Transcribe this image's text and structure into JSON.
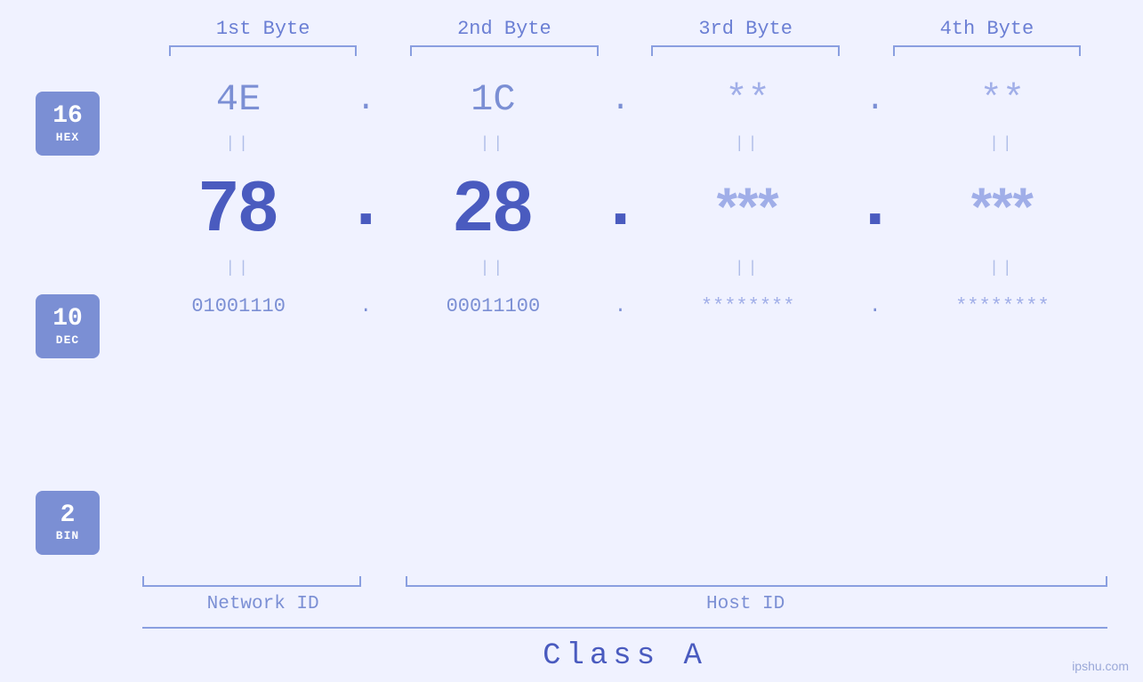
{
  "header": {
    "byte1": "1st Byte",
    "byte2": "2nd Byte",
    "byte3": "3rd Byte",
    "byte4": "4th Byte"
  },
  "badges": {
    "hex": {
      "number": "16",
      "label": "HEX"
    },
    "dec": {
      "number": "10",
      "label": "DEC"
    },
    "bin": {
      "number": "2",
      "label": "BIN"
    }
  },
  "values": {
    "hex": [
      "4E",
      "1C",
      "**",
      "**"
    ],
    "dec": [
      "78",
      "28",
      "***",
      "***"
    ],
    "bin": [
      "01001110",
      "00011100",
      "********",
      "********"
    ],
    "dots": [
      " . ",
      " . ",
      " . ",
      ""
    ]
  },
  "equals": "||",
  "labels": {
    "network_id": "Network ID",
    "host_id": "Host ID"
  },
  "class": "Class A",
  "watermark": "ipshu.com"
}
